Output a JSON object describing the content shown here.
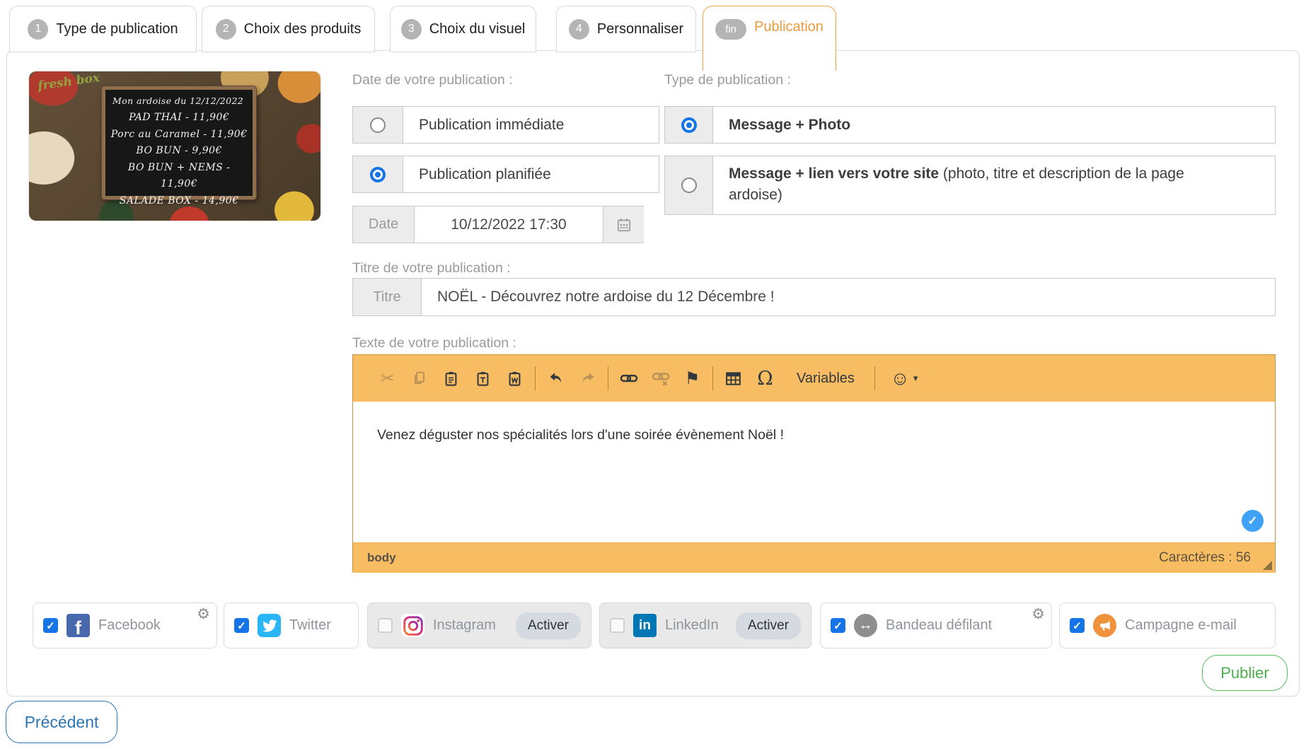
{
  "tabs": [
    {
      "badge": "1",
      "label": "Type de publication",
      "active": false
    },
    {
      "badge": "2",
      "label": "Choix des produits",
      "active": false
    },
    {
      "badge": "3",
      "label": "Choix du visuel",
      "active": false
    },
    {
      "badge": "4",
      "label": "Personnaliser",
      "active": false
    },
    {
      "badge": "fin",
      "label": "Publication",
      "active": true
    }
  ],
  "preview": {
    "logo": "fresh box",
    "board_title": "Mon ardoise du 12/12/2022",
    "menu": [
      "PAD THAI - 11,90€",
      "Porc au Caramel - 11,90€",
      "BO BUN - 9,90€",
      "BO BUN + NEMS - 11,90€",
      "SALADE BOX - 14,90€"
    ]
  },
  "date_section": {
    "label": "Date de votre publication :",
    "options": [
      {
        "label": "Publication immédiate",
        "selected": false
      },
      {
        "label": "Publication planifiée",
        "selected": true
      }
    ],
    "date_field": {
      "label": "Date",
      "value": "10/12/2022 17:30"
    }
  },
  "type_section": {
    "label": "Type de publication :",
    "options": [
      {
        "label_bold": "Message + Photo",
        "label_suffix": "",
        "selected": true
      },
      {
        "label_bold": "Message + lien vers votre site",
        "label_suffix": " (photo, titre et description de la page ardoise)",
        "selected": false
      }
    ]
  },
  "title_section": {
    "label": "Titre de votre publication :",
    "field_label": "Titre",
    "value": "NOËL - Découvrez notre ardoise du 12 Décembre !"
  },
  "text_section": {
    "label": "Texte de votre publication :",
    "toolbar_icons": [
      "cut",
      "copy",
      "paste",
      "paste-text",
      "paste-word",
      "undo",
      "redo",
      "link",
      "unlink",
      "anchor",
      "table",
      "special-character",
      "variables",
      "smiley"
    ],
    "variables_label": "Variables",
    "content": "Venez déguster nos spécialités lors d'une soirée évènement Noël !",
    "status_left": "body",
    "status_right": "Caractères : 56"
  },
  "channels": [
    {
      "name": "Facebook",
      "checked": true,
      "enabled": true,
      "gear": true
    },
    {
      "name": "Twitter",
      "checked": true,
      "enabled": true,
      "gear": false
    },
    {
      "name": "Instagram",
      "checked": false,
      "enabled": false,
      "action": "Activer"
    },
    {
      "name": "LinkedIn",
      "checked": false,
      "enabled": false,
      "action": "Activer"
    },
    {
      "name": "Bandeau défilant",
      "checked": true,
      "enabled": true,
      "gear": true
    },
    {
      "name": "Campagne e-mail",
      "checked": true,
      "enabled": true,
      "gear": false
    }
  ],
  "buttons": {
    "publish": "Publier",
    "previous": "Précédent"
  },
  "colors": {
    "accent_orange": "#f8bd62",
    "tab_active_orange": "#ef9b3e",
    "selection_blue": "#1574e6",
    "check_blue": "#3fa2f7",
    "publish_green": "#4caf50",
    "previous_blue": "#2e75b5"
  }
}
